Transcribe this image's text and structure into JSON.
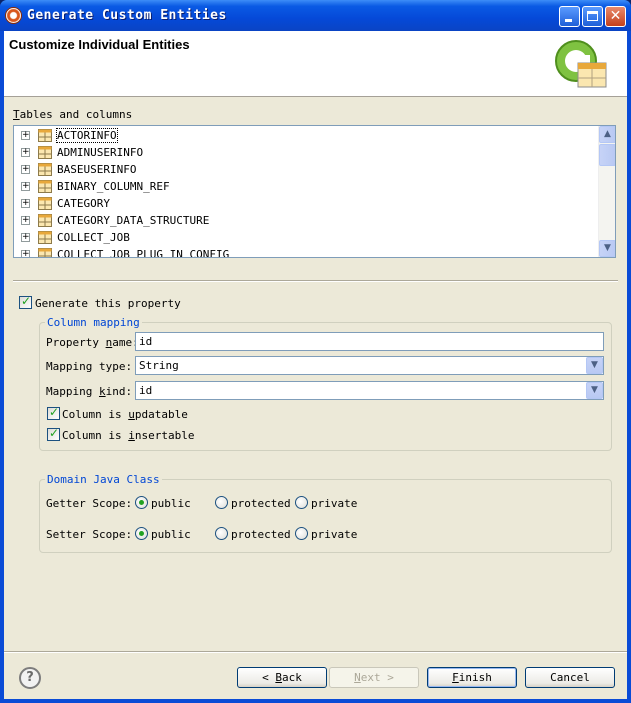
{
  "window": {
    "title": "Generate Custom Entities"
  },
  "header": {
    "title": "Customize Individual Entities"
  },
  "tables": {
    "label_mnemonic": "T",
    "label_rest": "ables and columns",
    "items": [
      {
        "name": "ACTORINFO",
        "selected": true
      },
      {
        "name": "ADMINUSERINFO"
      },
      {
        "name": "BASEUSERINFO"
      },
      {
        "name": "BINARY_COLUMN_REF"
      },
      {
        "name": "CATEGORY"
      },
      {
        "name": "CATEGORY_DATA_STRUCTURE"
      },
      {
        "name": "COLLECT_JOB"
      },
      {
        "name": "COLLECT_JOB_PLUG_IN_CONFIG"
      }
    ]
  },
  "generate_property": {
    "label": "Generate this property",
    "checked": true
  },
  "column_mapping": {
    "title": "Column mapping",
    "property_name_label_pre": "Property ",
    "property_name_label_mn": "n",
    "property_name_label_post": "ame:",
    "property_name_value": "id",
    "mapping_type_label": "Mapping type:",
    "mapping_type_value": "String",
    "mapping_kind_label_pre": "Mapping ",
    "mapping_kind_label_mn": "k",
    "mapping_kind_label_post": "ind:",
    "mapping_kind_value": "id",
    "updatable_pre": "Column is ",
    "updatable_mn": "u",
    "updatable_post": "pdatable",
    "updatable_checked": true,
    "insertable_pre": "Column is ",
    "insertable_mn": "i",
    "insertable_post": "nsertable",
    "insertable_checked": true
  },
  "domain_class": {
    "title": "Domain Java Class",
    "getter_label": "Getter Scope:",
    "setter_label": "Setter Scope:",
    "options": [
      "public",
      "protected",
      "private"
    ],
    "getter_selected": "public",
    "setter_selected": "public"
  },
  "footer": {
    "help_glyph": "?",
    "back_arrow": "<",
    "back_mn": "B",
    "back_rest": "ack",
    "next_mn": "N",
    "next_rest": "ext",
    "next_arrow": ">",
    "finish_mn": "F",
    "finish_rest": "inish",
    "cancel_label": "Cancel"
  },
  "colors": {
    "titlebar": "#0549d8",
    "dialog_bg": "#ece9d8",
    "group_title": "#0046d5",
    "check": "#21a121"
  }
}
